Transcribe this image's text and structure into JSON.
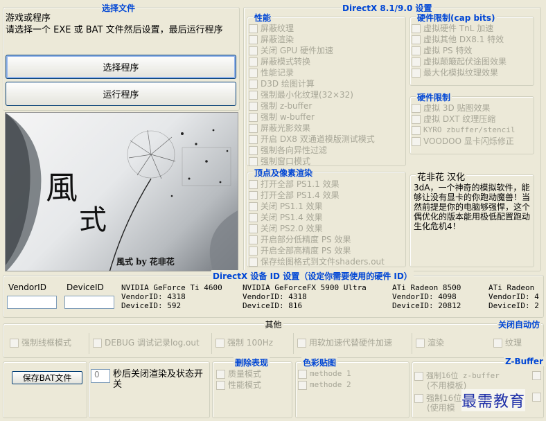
{
  "select_file": {
    "title": "选择文件",
    "game_label": "游戏或程序",
    "instruction": "请选择一个 EXE 或 BAT 文件然后设置，最后运行程序",
    "select_button": "选择程序",
    "run_button": "运行程序"
  },
  "banner": {
    "big_char_1": "風",
    "big_char_2": "式",
    "signature": "風式 by 花非花"
  },
  "dx": {
    "title": "DirectX 8.1/9.0 设置",
    "performance": {
      "title": "性能",
      "items": [
        "屏蔽纹理",
        "屏蔽渲染",
        "关闭 GPU 硬件加速",
        "屏蔽模式转换",
        "性能记录",
        "D3D 绘图计算",
        "强制最小化纹理(32×32)",
        "强制 z-buffer",
        "强制 w-buffer",
        "屏蔽光影效果",
        "开启 DX8 双通道模版测试模式",
        "强制各向异性过滤",
        "强制窗口模式"
      ]
    },
    "cap_bits": {
      "title": "硬件限制(cap bits)",
      "items": [
        "虚拟硬件 TnL 加速",
        "虚拟其他 DX8.1 特效",
        "虚拟 PS 特效",
        "虚拟颠簸起伏途图效果",
        "最大化模拟纹理效果"
      ]
    },
    "hw_limit": {
      "title": "硬件限制",
      "items": [
        "虚拟 3D 贴图效果",
        "虚拟 DXT 纹理压缩",
        "KYRO zbuffer/stencil",
        "VOODOO 显卡闪烁修正"
      ]
    },
    "shader": {
      "title": "顶点及像素渲染",
      "items": [
        "打开全部 PS1.1 效果",
        "打开全部 PS1.4 效果",
        "关闭 PS1.1 效果",
        "关闭 PS1.4 效果",
        "关闭 PS2.0 效果",
        "开启部分低精度 PS 效果",
        "开启全部高精度 PS 效果",
        "保存绘图格式到文件shaders.out"
      ]
    },
    "about": {
      "title": "花非花 汉化",
      "text": "3dA，一个神奇的模拟软件，能够让没有显卡的你跑动魔兽！当然前提是你的电脑够强悍，这个偶优化的版本能用极低配置跑动生化危机4！"
    }
  },
  "device": {
    "title": "DirectX 设备 ID 设置（设定你需要使用的硬件 ID）",
    "vendor_label": "VendorID",
    "device_label": "DeviceID",
    "vendor_value": "",
    "device_value": "",
    "gpus": [
      {
        "name": "NVIDIA GeForce Ti 4600",
        "vendor": "VendorID: 4318",
        "device": "DeviceID: 592"
      },
      {
        "name": "NVIDIA GeForceFX 5900 Ultra",
        "vendor": "VendorID: 4318",
        "device": "DeviceID: 816"
      },
      {
        "name": "ATi Radeon 8500",
        "vendor": "VendorID: 4098",
        "device": "DeviceID: 20812"
      },
      {
        "name": "ATi Radeon",
        "vendor": "VendorID: 4",
        "device": "DeviceID: 2"
      }
    ]
  },
  "other": {
    "title": "其他",
    "items": [
      "强制线框模式",
      "DEBUG 调试记录log.out",
      "强制 100Hz",
      "用软加速代替硬件加速",
      "渲染"
    ],
    "auto_title": "关闭自动仿",
    "auto_item": "纹理"
  },
  "bottom": {
    "save_button": "保存BAT文件",
    "seconds_value": "0",
    "seconds_label": "秒后关闭渲染及状态开关",
    "remove": {
      "title": "删除表现",
      "items": [
        "质量模式",
        "性能模式"
      ]
    },
    "color": {
      "title": "色彩贴图",
      "items": [
        "methode 1",
        "methode 2"
      ]
    },
    "zbuffer": {
      "title": "Z-Buffer",
      "items": [
        "强制16位 z-buffer",
        "(不用模板)",
        "强制16位",
        "(使用模"
      ]
    }
  },
  "watermark": "最需教育"
}
